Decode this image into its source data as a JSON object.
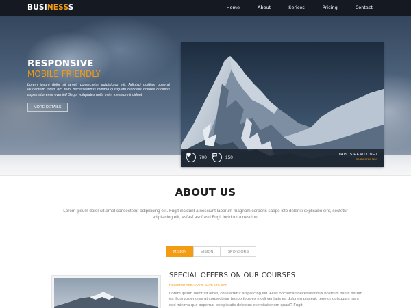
{
  "brand": {
    "part1": "BUSI",
    "part2": "NESS",
    "part3": "S"
  },
  "nav": {
    "items": [
      "Home",
      "About",
      "Serices",
      "Pricing",
      "Contact"
    ]
  },
  "hero": {
    "title_line1": "RESPONSIVE",
    "title_line2": "MOBILE FRIENDLY",
    "description": "Lorem ipsum dolor sit amet, consectetur adipisicing elit. Adipisci quidem quaerat laudantium totam hic, rem, necessitatibus minima quisquam blanditiis dolores ducimus aspernatur error eveniet! Sequi voluptates nulla enim inventore incidunt.",
    "button_label": "MORE DETAILS"
  },
  "card": {
    "likes": "700",
    "comments": "150",
    "headline": "THIS IS HEAD LINE1",
    "subline": "Sponsored text"
  },
  "about": {
    "title": "ABOUT US",
    "text": "Lorem ipsum dolor sit amet consectetur adipisicing elit. Fugit incidunt a nesciunt laborum magnam corporis saepe iste deleniti explicabo sint, sectetur adipisicing elit, asfasf asdf asd Fugit incidunt a nesciunt"
  },
  "tabs": [
    {
      "label": "MISION",
      "active": true
    },
    {
      "label": "VISION",
      "active": false
    },
    {
      "label": "SPONSORS",
      "active": false
    }
  ],
  "offers": {
    "title": "SPECIAL OFFERS ON OUR COURSES",
    "subtitle": "REGISTER TODAY AND SAVE 50% OFF",
    "text": "Lorem ipsum dolor sit amet, consectetur adipisicing elit. Alias obcaecati necessitatibus nostrum natus harum ea illum asperiores ut consectetur temporibus ex modi veritatis ea dolorem placeat, tenetur quisquam nam sed minima quo aspernat perspiciatis delectus exercitationem quasi? Fugit"
  },
  "colors": {
    "accent": "#f39c12",
    "navbar": "#141922",
    "card_footer": "#1b2430"
  },
  "icons": {
    "likes": "heart-icon",
    "comments": "chat-bubble-icon"
  }
}
